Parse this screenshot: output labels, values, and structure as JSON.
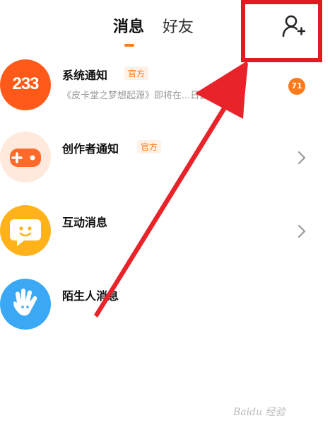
{
  "header": {
    "tabs": [
      {
        "label": "消息",
        "active": true
      },
      {
        "label": "好友",
        "active": false
      }
    ],
    "add_friend_icon": "person-plus-icon"
  },
  "messages": [
    {
      "title": "系统通知",
      "official_badge": "官方",
      "avatar_text": "233",
      "avatar_color": "#ff5a1a",
      "preview": "《皮卡堂之梦想起源》即将在...日正...",
      "unread": "71"
    },
    {
      "title": "创作者通知",
      "official_badge": "官方",
      "avatar_icon": "gamepad-icon",
      "avatar_color": "#ffe9dc"
    },
    {
      "title": "互动消息",
      "avatar_icon": "chat-face-icon",
      "avatar_color": "#ffb21a"
    },
    {
      "title": "陌生人消息",
      "avatar_icon": "hand-wave-icon",
      "avatar_color": "#3aa8f5"
    }
  ],
  "watermark": "Baidu 经验",
  "colors": {
    "accent": "#ff7a1a",
    "annotation": "#e21b22"
  }
}
